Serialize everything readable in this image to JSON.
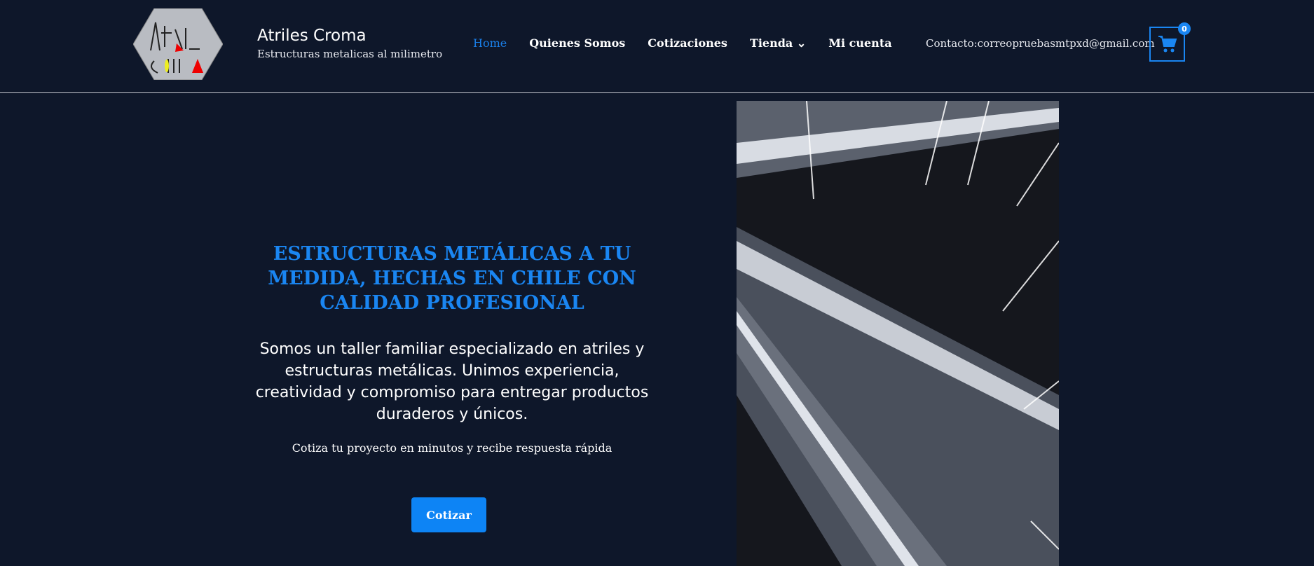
{
  "header": {
    "site_title": "Atriles Croma",
    "tagline": "Estructuras metalicas al milimetro",
    "nav": [
      {
        "label": "Home",
        "active": true
      },
      {
        "label": "Quienes Somos"
      },
      {
        "label": "Cotizaciones"
      },
      {
        "label": "Tienda ⌄"
      },
      {
        "label": "Mi cuenta"
      }
    ],
    "contact": "Contacto:correopruebasmtpxd@gmail.com",
    "cart_count": "0",
    "logo_text": "Atriles Croma"
  },
  "hero": {
    "title": "ESTRUCTURAS METÁLICAS A TU MEDIDA, HECHAS EN CHILE CON CALIDAD PROFESIONAL",
    "text": "Somos un taller familiar especializado en atriles y estructuras metálicas. Unimos experiencia, creatividad y compromiso para entregar productos duraderos y únicos.",
    "subtext": "Cotiza tu proyecto en minutos y recibe respuesta rápida",
    "button": "Cotizar"
  },
  "colors": {
    "background": "#0e172a",
    "accent": "#1a86f2"
  }
}
